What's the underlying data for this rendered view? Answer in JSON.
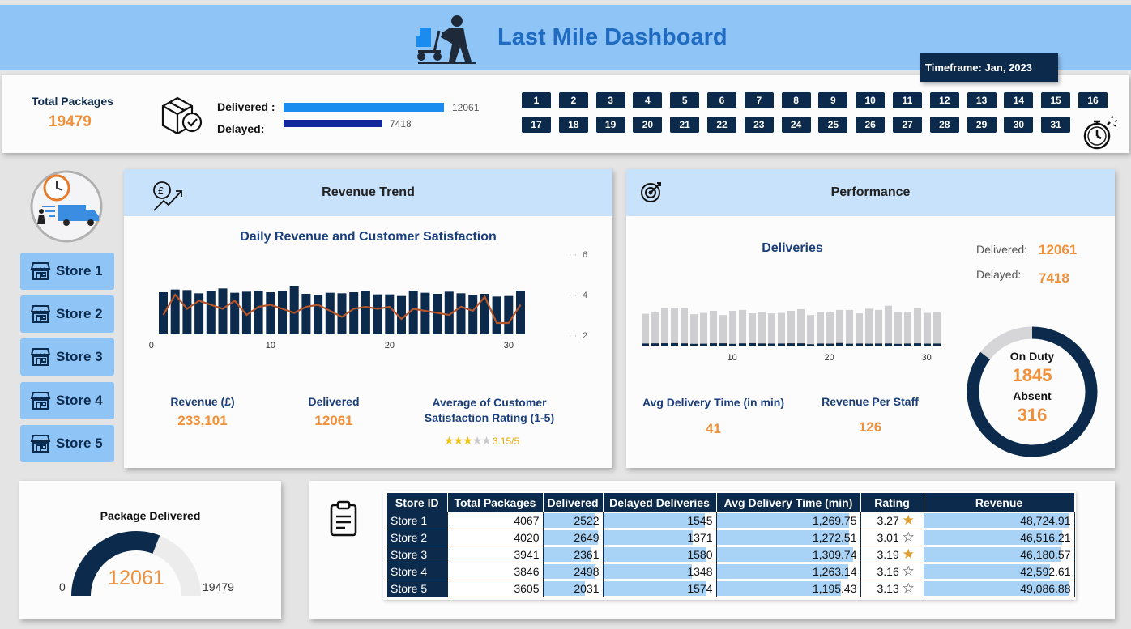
{
  "header": {
    "title": "Last Mile Dashboard"
  },
  "timeframe": "Timeframe: Jan, 2023",
  "total_packages": {
    "label": "Total Packages",
    "value": "19479"
  },
  "status_bars": [
    {
      "label": "Delivered :",
      "value": "12061",
      "fraction": 0.62,
      "color": "#1a8cf0"
    },
    {
      "label": "Delayed:",
      "value": "7418",
      "fraction": 0.38,
      "color": "#12289c"
    }
  ],
  "days": [
    "1",
    "2",
    "3",
    "4",
    "5",
    "6",
    "7",
    "8",
    "9",
    "10",
    "11",
    "12",
    "13",
    "14",
    "15",
    "16",
    "17",
    "18",
    "19",
    "20",
    "21",
    "22",
    "23",
    "24",
    "25",
    "26",
    "27",
    "28",
    "29",
    "30",
    "31"
  ],
  "stores": [
    "Store 1",
    "Store 2",
    "Store 3",
    "Store 4",
    "Store 5"
  ],
  "revenue_panel": {
    "header": "Revenue Trend",
    "chart_title": "Daily Revenue and Customer Satisfaction",
    "kpis": [
      {
        "label": "Revenue (£)",
        "value": "233,101"
      },
      {
        "label": "Delivered",
        "value": "12061"
      },
      {
        "label": "Average of Customer Satisfaction Rating (1-5)",
        "value": "3.15/5"
      }
    ],
    "rating_stars": 3.15
  },
  "performance_panel": {
    "header": "Performance",
    "chart_title": "Deliveries",
    "delivered_label": "Delivered:",
    "delivered_value": "12061",
    "delayed_label": "Delayed:",
    "delayed_value": "7418",
    "kpis": [
      {
        "label": "Avg Delivery Time (in min)",
        "value": "41"
      },
      {
        "label": "Revenue Per Staff",
        "value": "126"
      }
    ],
    "donut": {
      "on_duty_label": "On Duty",
      "on_duty": "1845",
      "absent_label": "Absent",
      "absent": "316",
      "on_duty_fraction": 0.854
    }
  },
  "gauge": {
    "title": "Package Delivered",
    "value": "12061",
    "min": "0",
    "max": "19479",
    "fraction": 0.619
  },
  "table": {
    "columns": [
      "Store ID",
      "Total Packages",
      "Delivered",
      "Delayed Deliveries",
      "Avg Delivery Time (min)",
      "Rating",
      "Revenue"
    ],
    "rows": [
      {
        "id": "Store 1",
        "total": "4067",
        "delivered": "2522",
        "delayed": "1545",
        "avg": "1,269.75",
        "rating": "3.27",
        "star": "full",
        "revenue": "48,724.91"
      },
      {
        "id": "Store 2",
        "total": "4020",
        "delivered": "2649",
        "delayed": "1371",
        "avg": "1,272.51",
        "rating": "3.01",
        "star": "empty",
        "revenue": "46,516.21"
      },
      {
        "id": "Store 3",
        "total": "3941",
        "delivered": "2361",
        "delayed": "1580",
        "avg": "1,309.74",
        "rating": "3.19",
        "star": "full",
        "revenue": "46,180.57"
      },
      {
        "id": "Store 4",
        "total": "3846",
        "delivered": "2498",
        "delayed": "1348",
        "avg": "1,263.14",
        "rating": "3.16",
        "star": "half",
        "revenue": "42,592.61"
      },
      {
        "id": "Store 5",
        "total": "3605",
        "delivered": "2031",
        "delayed": "1574",
        "avg": "1,195.43",
        "rating": "3.13",
        "star": "half",
        "revenue": "49,086.88"
      }
    ]
  },
  "chart_data": [
    {
      "type": "bar",
      "title": "Daily Revenue and Customer Satisfaction",
      "x": [
        1,
        2,
        3,
        4,
        5,
        6,
        7,
        8,
        9,
        10,
        11,
        12,
        13,
        14,
        15,
        16,
        17,
        18,
        19,
        20,
        21,
        22,
        23,
        24,
        25,
        26,
        27,
        28,
        29,
        30,
        31
      ],
      "x_ticks": [
        "0",
        "10",
        "20",
        "30"
      ],
      "series": [
        {
          "kind": "bar",
          "values": [
            7800,
            8300,
            8200,
            7600,
            8000,
            8500,
            7700,
            7900,
            8100,
            7800,
            8000,
            9000,
            7500,
            7300,
            7700,
            7600,
            7800,
            8000,
            7400,
            7400,
            7100,
            8100,
            7700,
            7500,
            7900,
            7600,
            7300,
            7500,
            7000,
            7100,
            8100
          ]
        },
        {
          "kind": "line",
          "values": [
            3.0,
            4.0,
            3.3,
            3.7,
            3.5,
            3.3,
            3.7,
            3.0,
            3.4,
            3.5,
            3.3,
            3.1,
            3.4,
            3.5,
            3.2,
            2.9,
            3.3,
            3.4,
            3.3,
            3.4,
            2.8,
            3.3,
            3.2,
            3.1,
            3.0,
            3.4,
            3.2,
            3.9,
            2.6,
            2.6,
            3.5
          ]
        }
      ],
      "y2_ticks": [
        "2",
        "4",
        "6"
      ],
      "y2lim": [
        2,
        6
      ]
    },
    {
      "type": "bar",
      "title": "Deliveries",
      "x": [
        1,
        2,
        3,
        4,
        5,
        6,
        7,
        8,
        9,
        10,
        11,
        12,
        13,
        14,
        15,
        16,
        17,
        18,
        19,
        20,
        21,
        22,
        23,
        24,
        25,
        26,
        27,
        28,
        29,
        30,
        31
      ],
      "x_ticks": [
        "10",
        "20",
        "30"
      ],
      "series": [
        {
          "name": "Delivered",
          "values": [
            375,
            390,
            440,
            440,
            440,
            370,
            385,
            410,
            360,
            410,
            420,
            380,
            400,
            380,
            385,
            410,
            430,
            360,
            400,
            390,
            420,
            420,
            380,
            435,
            420,
            470,
            390,
            400,
            440,
            385,
            390
          ]
        },
        {
          "name": "Delayed",
          "values": [
            250,
            270,
            280,
            295,
            265,
            210,
            225,
            275,
            275,
            205,
            265,
            290,
            255,
            240,
            245,
            275,
            270,
            170,
            245,
            235,
            310,
            225,
            250,
            230,
            245,
            255,
            205,
            245,
            275,
            235,
            245
          ]
        }
      ]
    }
  ]
}
